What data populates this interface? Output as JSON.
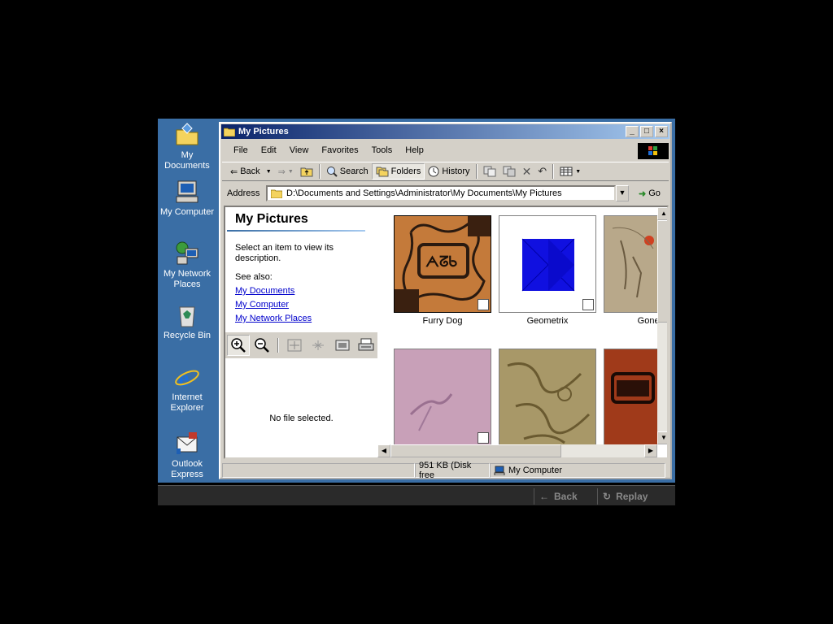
{
  "desktop": {
    "icons": [
      {
        "label_lines": [
          "My Documents"
        ],
        "icon": "my-documents-icon"
      },
      {
        "label_lines": [
          "My Computer"
        ],
        "icon": "my-computer-icon"
      },
      {
        "label_lines": [
          "My Network",
          "Places"
        ],
        "icon": "network-places-icon"
      },
      {
        "label_lines": [
          "Recycle Bin"
        ],
        "icon": "recycle-bin-icon"
      },
      {
        "label_lines": [
          "Internet",
          "Explorer"
        ],
        "icon": "internet-explorer-icon"
      },
      {
        "label_lines": [
          "Outlook",
          "Express"
        ],
        "icon": "outlook-express-icon"
      }
    ]
  },
  "window": {
    "title": "My Pictures",
    "controls": {
      "minimize": "_",
      "maximize": "□",
      "close": "×"
    },
    "menu": [
      "File",
      "Edit",
      "View",
      "Favorites",
      "Tools",
      "Help"
    ],
    "toolbar": {
      "back": "Back",
      "search": "Search",
      "folders": "Folders",
      "history": "History"
    },
    "address": {
      "label": "Address",
      "value": "D:\\Documents and Settings\\Administrator\\My Documents\\My Pictures",
      "go": "Go"
    },
    "left_pane": {
      "title": "My Pictures",
      "description": "Select an item to view its description.",
      "see_also": "See also:",
      "links": [
        "My Documents",
        "My Computer",
        "My Network Places"
      ],
      "no_file": "No file selected."
    },
    "thumbnails": [
      {
        "label": "Furry Dog",
        "bg": "#c47a3a"
      },
      {
        "label": "Geometrix",
        "bg": "#ffffff"
      },
      {
        "label": "Gone F",
        "bg": "#b8a88a"
      },
      {
        "label": "",
        "bg": "#c8a0b8"
      },
      {
        "label": "",
        "bg": "#a89868"
      },
      {
        "label": "",
        "bg": "#a03a1a"
      }
    ],
    "status": {
      "size": "951 KB (Disk free",
      "zone": "My Computer"
    }
  },
  "player": {
    "back": "Back",
    "replay": "Replay"
  },
  "colors": {
    "desktop": "#3a6ea5",
    "title_start": "#0a246a",
    "title_end": "#a6caf0",
    "link": "#0000cc"
  }
}
